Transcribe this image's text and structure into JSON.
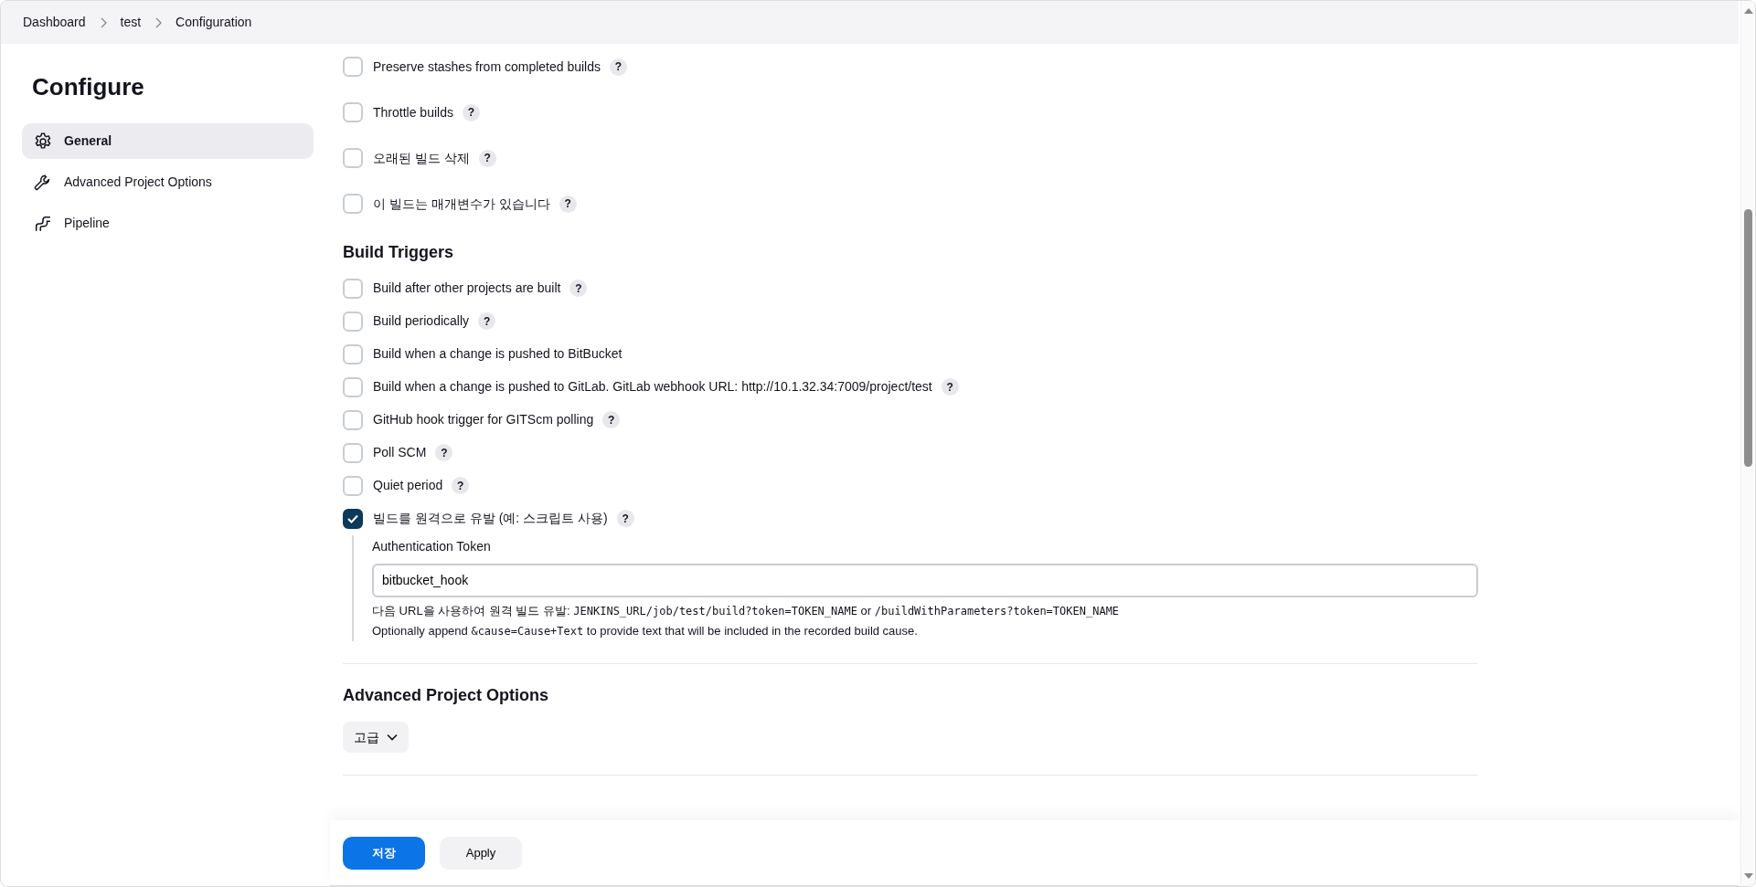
{
  "breadcrumbs": [
    {
      "label": "Dashboard"
    },
    {
      "label": "test"
    },
    {
      "label": "Configuration"
    }
  ],
  "sidebar": {
    "title": "Configure",
    "items": [
      {
        "label": "General",
        "kind": "gear",
        "selected": true
      },
      {
        "label": "Advanced Project Options",
        "kind": "wrench",
        "selected": false
      },
      {
        "label": "Pipeline",
        "kind": "pipeline",
        "selected": false
      }
    ]
  },
  "general_options": [
    {
      "label": "Preserve stashes from completed builds",
      "checked": false,
      "help": "?"
    },
    {
      "label": "Throttle builds",
      "checked": false,
      "help": "?"
    },
    {
      "label": "오래된 빌드 삭제",
      "checked": false,
      "help": "?"
    },
    {
      "label": "이 빌드는 매개변수가 있습니다",
      "checked": false,
      "help": "?"
    }
  ],
  "build_triggers": {
    "title": "Build Triggers",
    "options": [
      {
        "label": "Build after other projects are built",
        "checked": false,
        "help": "?"
      },
      {
        "label": "Build periodically",
        "checked": false,
        "help": "?"
      },
      {
        "label": "Build when a change is pushed to BitBucket",
        "checked": false
      },
      {
        "label": "Build when a change is pushed to GitLab. GitLab webhook URL: http://10.1.32.34:7009/project/test",
        "checked": false,
        "help": "?"
      },
      {
        "label": "GitHub hook trigger for GITScm polling",
        "checked": false,
        "help": "?"
      },
      {
        "label": "Poll SCM",
        "checked": false,
        "help": "?"
      },
      {
        "label": "Quiet period",
        "checked": false,
        "help": "?"
      },
      {
        "label": "빌드를 원격으로 유발 (예: 스크립트 사용)",
        "checked": true,
        "help": "?",
        "details": {
          "field_label": "Authentication Token",
          "value": "bitbucket_hook",
          "hint_segments": [
            {
              "kind": "text",
              "text": "다음 URL을 사용하여 원격 빌드 유발: "
            },
            {
              "kind": "code",
              "text": "JENKINS_URL/job/test/build?token=TOKEN_NAME"
            },
            {
              "kind": "text",
              "text": " or "
            },
            {
              "kind": "code",
              "text": "/buildWithParameters?token=TOKEN_NAME"
            }
          ],
          "note_segments": [
            {
              "kind": "text",
              "text": "Optionally append "
            },
            {
              "kind": "code",
              "text": "&cause=Cause+Text"
            },
            {
              "kind": "text",
              "text": " to provide text that will be included in the recorded build cause."
            }
          ]
        }
      }
    ]
  },
  "advanced": {
    "title": "Advanced Project Options",
    "button": "고급"
  },
  "buttons": [
    {
      "label": "저장",
      "kind": "primary"
    },
    {
      "label": "Apply",
      "kind": "secondary"
    }
  ]
}
